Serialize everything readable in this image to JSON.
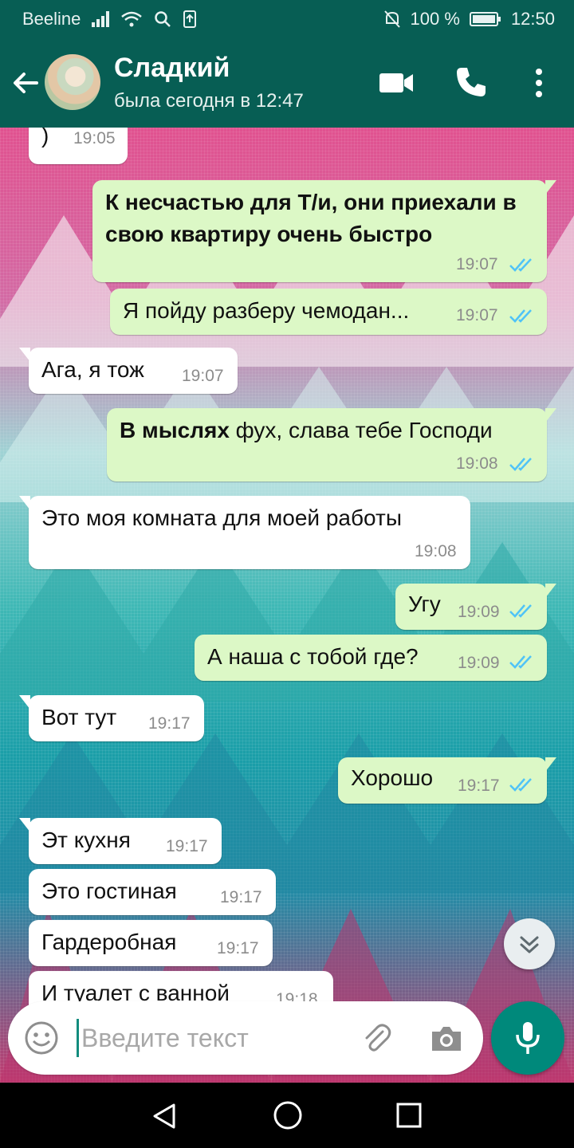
{
  "status_bar": {
    "carrier": "Beeline",
    "battery": "100 %",
    "time": "12:50",
    "icons": [
      "signal-icon",
      "wifi-icon",
      "search-icon",
      "upload-icon",
      "mute-icon",
      "battery-icon"
    ]
  },
  "header": {
    "contact_name": "Сладкий",
    "last_seen": "была сегодня в 12:47",
    "icons": [
      "back-arrow-icon",
      "video-call-icon",
      "phone-icon",
      "more-vert-icon"
    ]
  },
  "messages": [
    {
      "dir": "in",
      "text": ")",
      "time": "19:05"
    },
    {
      "dir": "out",
      "text": "К несчастью для Т/и, они приехали в свою квартиру очень быстро",
      "time": "19:07",
      "read": true
    },
    {
      "dir": "out",
      "text": "Я пойду разберу чемодан...",
      "time": "19:07",
      "read": true
    },
    {
      "dir": "in",
      "text": "Ага, я тож",
      "time": "19:07"
    },
    {
      "dir": "out",
      "bold_prefix": "В мыслях",
      "text": " фух, слава тебе Господи",
      "time": "19:08",
      "read": true
    },
    {
      "dir": "in",
      "text": "Это моя комната для моей работы",
      "time": "19:08"
    },
    {
      "dir": "out",
      "text": "Угу",
      "time": "19:09",
      "read": true
    },
    {
      "dir": "out",
      "text": "А наша с тобой где?",
      "time": "19:09",
      "read": true
    },
    {
      "dir": "in",
      "text": "Вот тут",
      "time": "19:17"
    },
    {
      "dir": "out",
      "text": "Хорошо",
      "time": "19:17",
      "read": true
    },
    {
      "dir": "in",
      "text": "Эт кухня",
      "time": "19:17"
    },
    {
      "dir": "in",
      "text": "Это гостиная",
      "time": "19:17"
    },
    {
      "dir": "in",
      "text": "Гардеробная",
      "time": "19:17"
    },
    {
      "dir": "in",
      "text": "И туалет с ванной",
      "time": "19:18"
    }
  ],
  "composer": {
    "placeholder": "Введите текст",
    "icons": [
      "emoji-icon",
      "attach-icon",
      "camera-icon",
      "mic-icon",
      "scroll-down-icon"
    ]
  },
  "colors": {
    "header": "#075e54",
    "outgoing_bubble": "#dcf8c6",
    "incoming_bubble": "#ffffff",
    "read_ticks": "#4fc3f7",
    "fab": "#00897b"
  }
}
